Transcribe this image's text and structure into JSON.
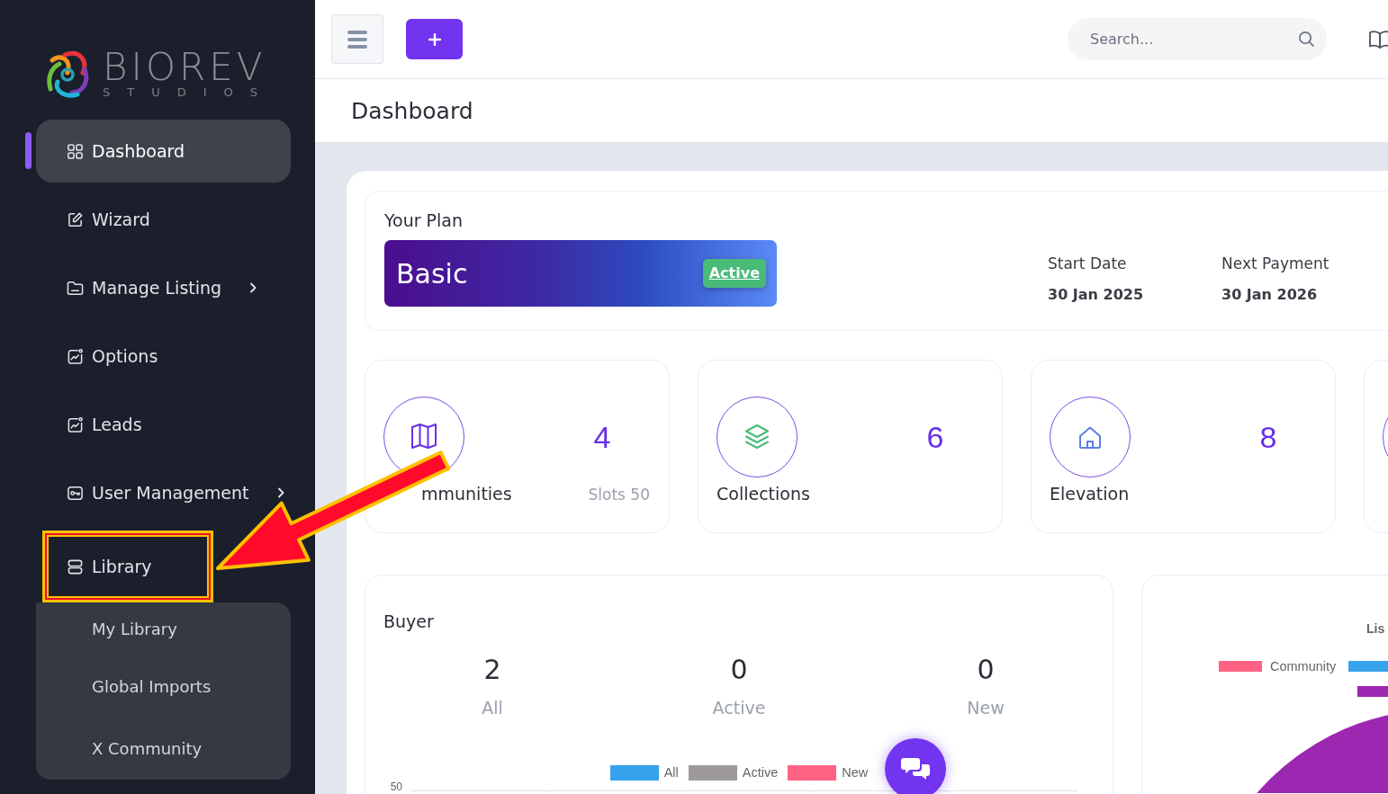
{
  "logo": {
    "name": "BIOREV",
    "tagline": "STUDIOS"
  },
  "sidebar": {
    "items": [
      {
        "label": "Dashboard",
        "selected": true,
        "highlighted": false
      },
      {
        "label": "Wizard",
        "selected": false,
        "highlighted": false
      },
      {
        "label": "Manage Listing",
        "selected": false,
        "highlighted": false,
        "expanded": false
      },
      {
        "label": "Options",
        "selected": false,
        "highlighted": false
      },
      {
        "label": "Leads",
        "selected": false,
        "highlighted": false
      },
      {
        "label": "User Management",
        "selected": false,
        "highlighted": false,
        "expanded": false
      },
      {
        "label": "Library",
        "selected": false,
        "highlighted": true,
        "expanded": true,
        "children": [
          {
            "label": "My Library"
          },
          {
            "label": "Global Imports"
          },
          {
            "label": "X Community"
          }
        ]
      }
    ]
  },
  "topbar": {
    "search": {
      "placeholder": "Search..."
    }
  },
  "page_header": {
    "title": "Dashboard"
  },
  "plan": {
    "heading": "Your Plan",
    "name": "Basic",
    "status": "Active",
    "dates": [
      {
        "label": "Start Date",
        "value": "30 Jan 2025"
      },
      {
        "label": "Next Payment",
        "value": "30 Jan 2026"
      }
    ]
  },
  "stats": [
    {
      "label": "mmunities",
      "value": "4",
      "note": "Slots 50"
    },
    {
      "label": "Collections",
      "value": "6"
    },
    {
      "label": "Elevation",
      "value": "8"
    }
  ],
  "buyer": {
    "title": "Buyer",
    "counts": [
      {
        "value": "2",
        "label": "All"
      },
      {
        "value": "0",
        "label": "Active"
      },
      {
        "value": "0",
        "label": "New"
      }
    ],
    "chart": {
      "legend": [
        {
          "label": "All",
          "color": "#36a2eb"
        },
        {
          "label": "Active",
          "color": "#9e9a9a"
        },
        {
          "label": "New",
          "color": "#ff6384"
        }
      ],
      "y_tick": "50"
    }
  },
  "listings": {
    "title": "Lis",
    "legend": [
      {
        "label": "Community",
        "color": "#ff6384"
      },
      {
        "color": "#36a2eb"
      },
      {
        "color": "#9c27b0"
      }
    ],
    "slice": {
      "color": "#9c27b0"
    }
  }
}
